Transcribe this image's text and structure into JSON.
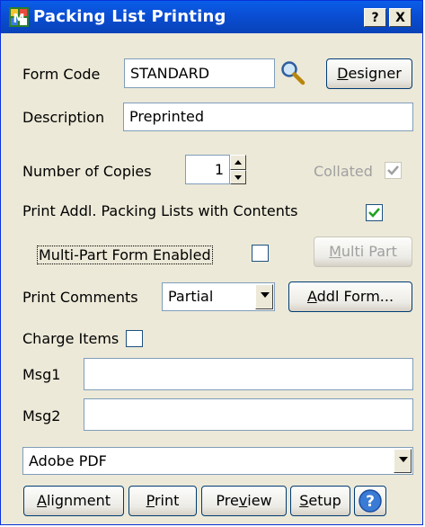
{
  "window": {
    "title": "Packing List Printing",
    "help_glyph": "?",
    "close_glyph": "X"
  },
  "form_code": {
    "label": "Form Code",
    "value": "STANDARD"
  },
  "designer_button": {
    "accel": "D",
    "rest": "esigner"
  },
  "description": {
    "label": "Description",
    "value": "Preprinted"
  },
  "copies": {
    "label": "Number of Copies",
    "value": "1"
  },
  "collated": {
    "label": "Collated",
    "checked": true,
    "enabled": false
  },
  "print_addl": {
    "label": "Print Addl. Packing Lists with Contents",
    "checked": true
  },
  "multi_part": {
    "label": "Multi-Part Form Enabled",
    "checked": false
  },
  "multi_part_button": {
    "accel": "M",
    "rest": "ulti Part"
  },
  "print_comments": {
    "label": "Print Comments",
    "value": "Partial"
  },
  "addl_form_button": {
    "accel": "A",
    "rest": "ddl Form..."
  },
  "charge_items": {
    "label": "Charge Items",
    "checked": false
  },
  "msg1": {
    "label": "Msg1",
    "value": ""
  },
  "msg2": {
    "label": "Msg2",
    "value": ""
  },
  "printer": {
    "value": "Adobe PDF"
  },
  "buttons": {
    "alignment": {
      "accel": "A",
      "rest": "lignment"
    },
    "print": {
      "accel": "P",
      "rest": "rint"
    },
    "preview": {
      "pre": "Pre",
      "accel": "v",
      "rest": "iew"
    },
    "setup": {
      "accel": "S",
      "rest": "etup"
    }
  },
  "colors": {
    "titlebar": "#0a4fd6",
    "face": "#ece9d8",
    "check": "#21a121"
  }
}
